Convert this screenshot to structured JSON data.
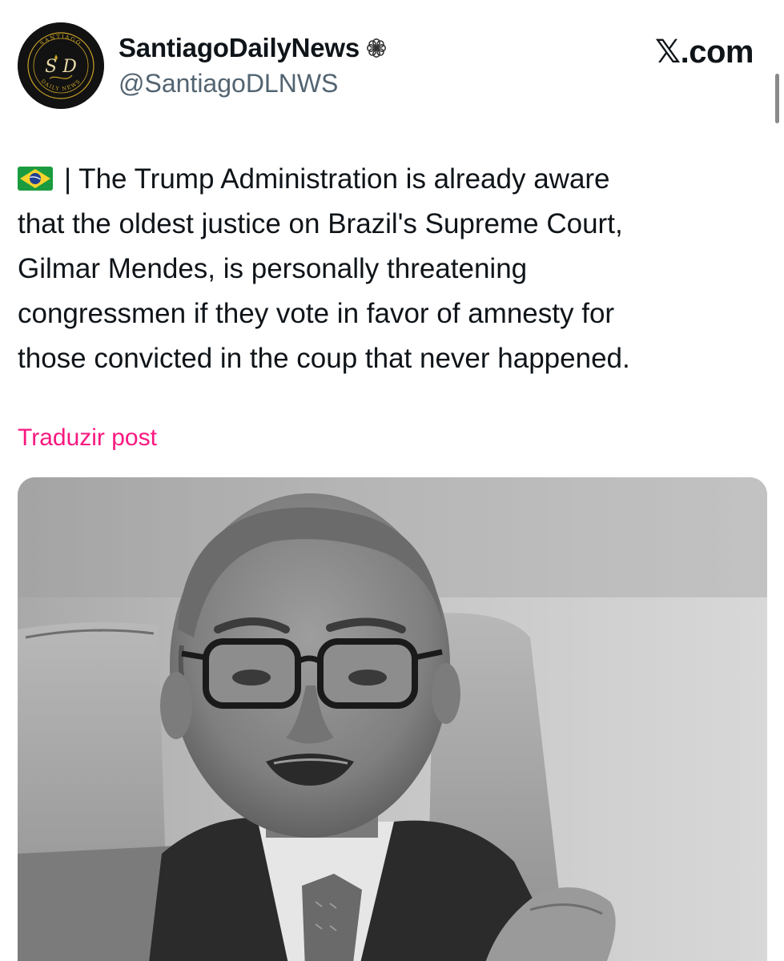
{
  "author": {
    "display_name": "SantiagoDailyNews",
    "handle": "@SantiagoDLNWS",
    "name_badge_icon": "flower-icon",
    "avatar_icon": "santiago-daily-news-logo",
    "avatar_logo_text": {
      "top": "SANTIAGO",
      "monogram": "S D",
      "bottom": "DAILY NEWS"
    }
  },
  "site_brand": "𝕏.com",
  "post": {
    "flag_icon": "brazil-flag-icon",
    "lines": [
      "| The Trump Administration is already aware",
      "that the oldest justice on Brazil's Supreme Court,",
      "Gilmar Mendes, is personally threatening",
      "congressmen if they vote in favor of amnesty for",
      "those convicted in the coup that never happened."
    ],
    "translate_label": "Traduzir post"
  },
  "media": {
    "type": "black-and-white photo"
  },
  "colors": {
    "text_primary": "#0f1419",
    "text_secondary": "#536471",
    "translate_link": "#f91880",
    "brazil_green": "#1b9b3f",
    "brazil_yellow": "#f6d32d",
    "brazil_blue": "#1f3f93"
  }
}
